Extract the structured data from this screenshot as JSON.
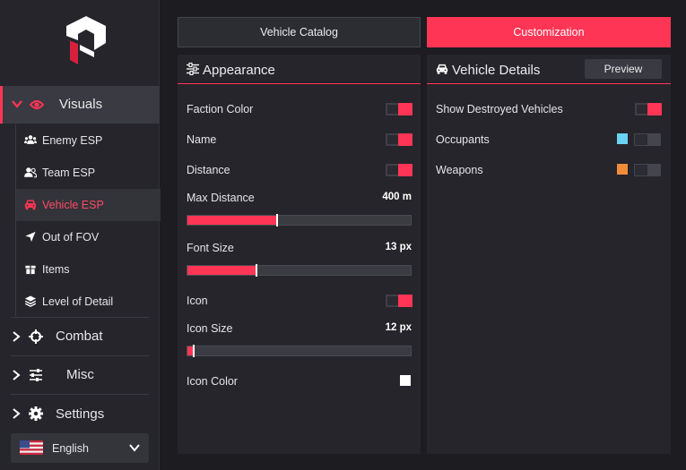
{
  "sidebar": {
    "categories": [
      {
        "label": "Visuals",
        "icon": "eye-icon",
        "expanded": true
      },
      {
        "label": "Combat",
        "icon": "crosshair-icon",
        "expanded": false
      },
      {
        "label": "Misc",
        "icon": "sliders-icon",
        "expanded": false
      },
      {
        "label": "Settings",
        "icon": "gear-icon",
        "expanded": false
      }
    ],
    "sub_items": [
      {
        "label": "Enemy ESP",
        "icon": "users-icon",
        "active": false
      },
      {
        "label": "Team ESP",
        "icon": "user-group-icon",
        "active": false
      },
      {
        "label": "Vehicle ESP",
        "icon": "car-icon",
        "active": true
      },
      {
        "label": "Out of FOV",
        "icon": "location-arrow-icon",
        "active": false
      },
      {
        "label": "Items",
        "icon": "gift-box-icon",
        "active": false
      },
      {
        "label": "Level of Detail",
        "icon": "layers-icon",
        "active": false
      }
    ],
    "language": {
      "label": "English",
      "flag": "us-flag-icon"
    }
  },
  "tabs": [
    {
      "label": "Vehicle Catalog",
      "active": false
    },
    {
      "label": "Customization",
      "active": true
    }
  ],
  "appearance": {
    "title": "Appearance",
    "faction_color": {
      "label": "Faction Color",
      "enabled": true
    },
    "name": {
      "label": "Name",
      "enabled": true
    },
    "distance": {
      "label": "Distance",
      "enabled": true
    },
    "max_distance": {
      "label": "Max Distance",
      "value": "400 m",
      "fraction": 0.4
    },
    "font_size": {
      "label": "Font Size",
      "value": "13 px",
      "fraction": 0.31
    },
    "icon": {
      "label": "Icon",
      "enabled": true
    },
    "icon_size": {
      "label": "Icon Size",
      "value": "12 px",
      "fraction": 0.03
    },
    "icon_color": {
      "label": "Icon Color",
      "color": "#ffffff"
    }
  },
  "vehicle_details": {
    "title": "Vehicle Details",
    "preview_label": "Preview",
    "show_destroyed": {
      "label": "Show Destroyed Vehicles",
      "enabled": true
    },
    "occupants": {
      "label": "Occupants",
      "enabled": false,
      "color": "#6ad3f5"
    },
    "weapons": {
      "label": "Weapons",
      "enabled": false,
      "color": "#f28c3a"
    }
  },
  "colors": {
    "accent": "#ff3555",
    "background": "#1c1c21",
    "panel": "#25252b"
  }
}
